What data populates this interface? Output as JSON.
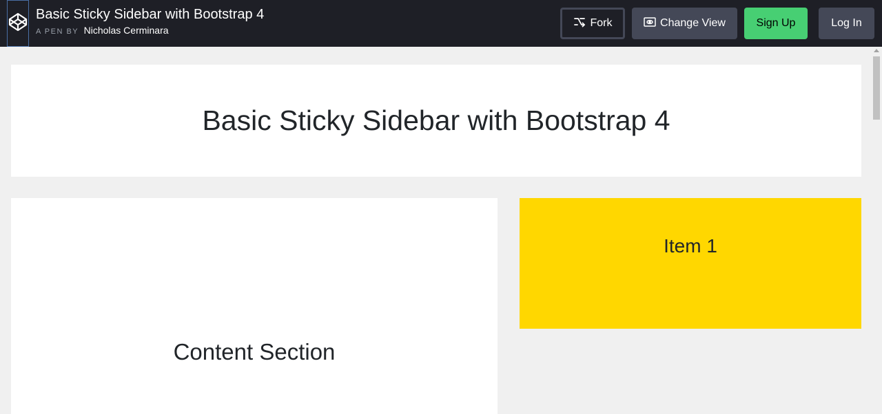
{
  "header": {
    "pen_title": "Basic Sticky Sidebar with Bootstrap 4",
    "pen_by_label": "A PEN BY",
    "author": "Nicholas Cerminara",
    "logo_icon": "codepen-logo-icon"
  },
  "actions": {
    "fork": "Fork",
    "change_view": "Change View",
    "sign_up": "Sign Up",
    "log_in": "Log In"
  },
  "page": {
    "title": "Basic Sticky Sidebar with Bootstrap 4",
    "content_section": "Content Section",
    "sidebar_item": "Item 1"
  },
  "colors": {
    "topbar": "#1e1f26",
    "button_gray": "#444857",
    "sign_up_green": "#47cf73",
    "sidebar_item_yellow": "#ffd700",
    "page_background": "#f0f0f0"
  }
}
